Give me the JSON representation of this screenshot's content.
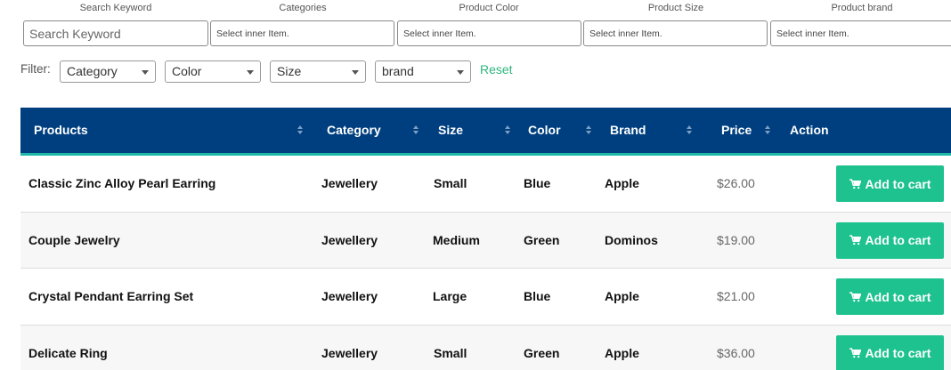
{
  "search": {
    "labels": [
      "Search Keyword",
      "Categories",
      "Product Color",
      "Product Size",
      "Product brand"
    ],
    "keyword_placeholder": "Search Keyword",
    "inner_placeholder": "Select inner Item."
  },
  "filter": {
    "label": "Filter:",
    "category": "Category",
    "color": "Color",
    "size": "Size",
    "brand": "brand",
    "reset": "Reset"
  },
  "table": {
    "headers": {
      "products": "Products",
      "category": "Category",
      "size": "Size",
      "color": "Color",
      "brand": "Brand",
      "price": "Price",
      "action": "Action"
    },
    "rows": [
      {
        "product": "Classic Zinc Alloy Pearl Earring",
        "category": "Jewellery",
        "size": "Small",
        "color": "Blue",
        "brand": "Apple",
        "price": "$26.00",
        "action": "Add to cart"
      },
      {
        "product": "Couple Jewelry",
        "category": "Jewellery",
        "size": "Medium",
        "color": "Green",
        "brand": "Dominos",
        "price": "$19.00",
        "action": "Add to cart"
      },
      {
        "product": "Crystal Pendant Earring Set",
        "category": "Jewellery",
        "size": "Large",
        "color": "Blue",
        "brand": "Apple",
        "price": "$21.00",
        "action": "Add to cart"
      },
      {
        "product": "Delicate Ring",
        "category": "Jewellery",
        "size": "Small",
        "color": "Green",
        "brand": "Apple",
        "price": "$36.00",
        "action": "Add to cart"
      }
    ]
  },
  "theme": {
    "header_bg": "#003f7f",
    "accent_teal": "#1fb8a6",
    "button_green": "#1ec28f",
    "reset_link": "#2eb67d"
  },
  "icons": {
    "cart": "shopping-cart-icon",
    "sort": "sort-icon",
    "dropdown": "chevron-down-icon"
  }
}
